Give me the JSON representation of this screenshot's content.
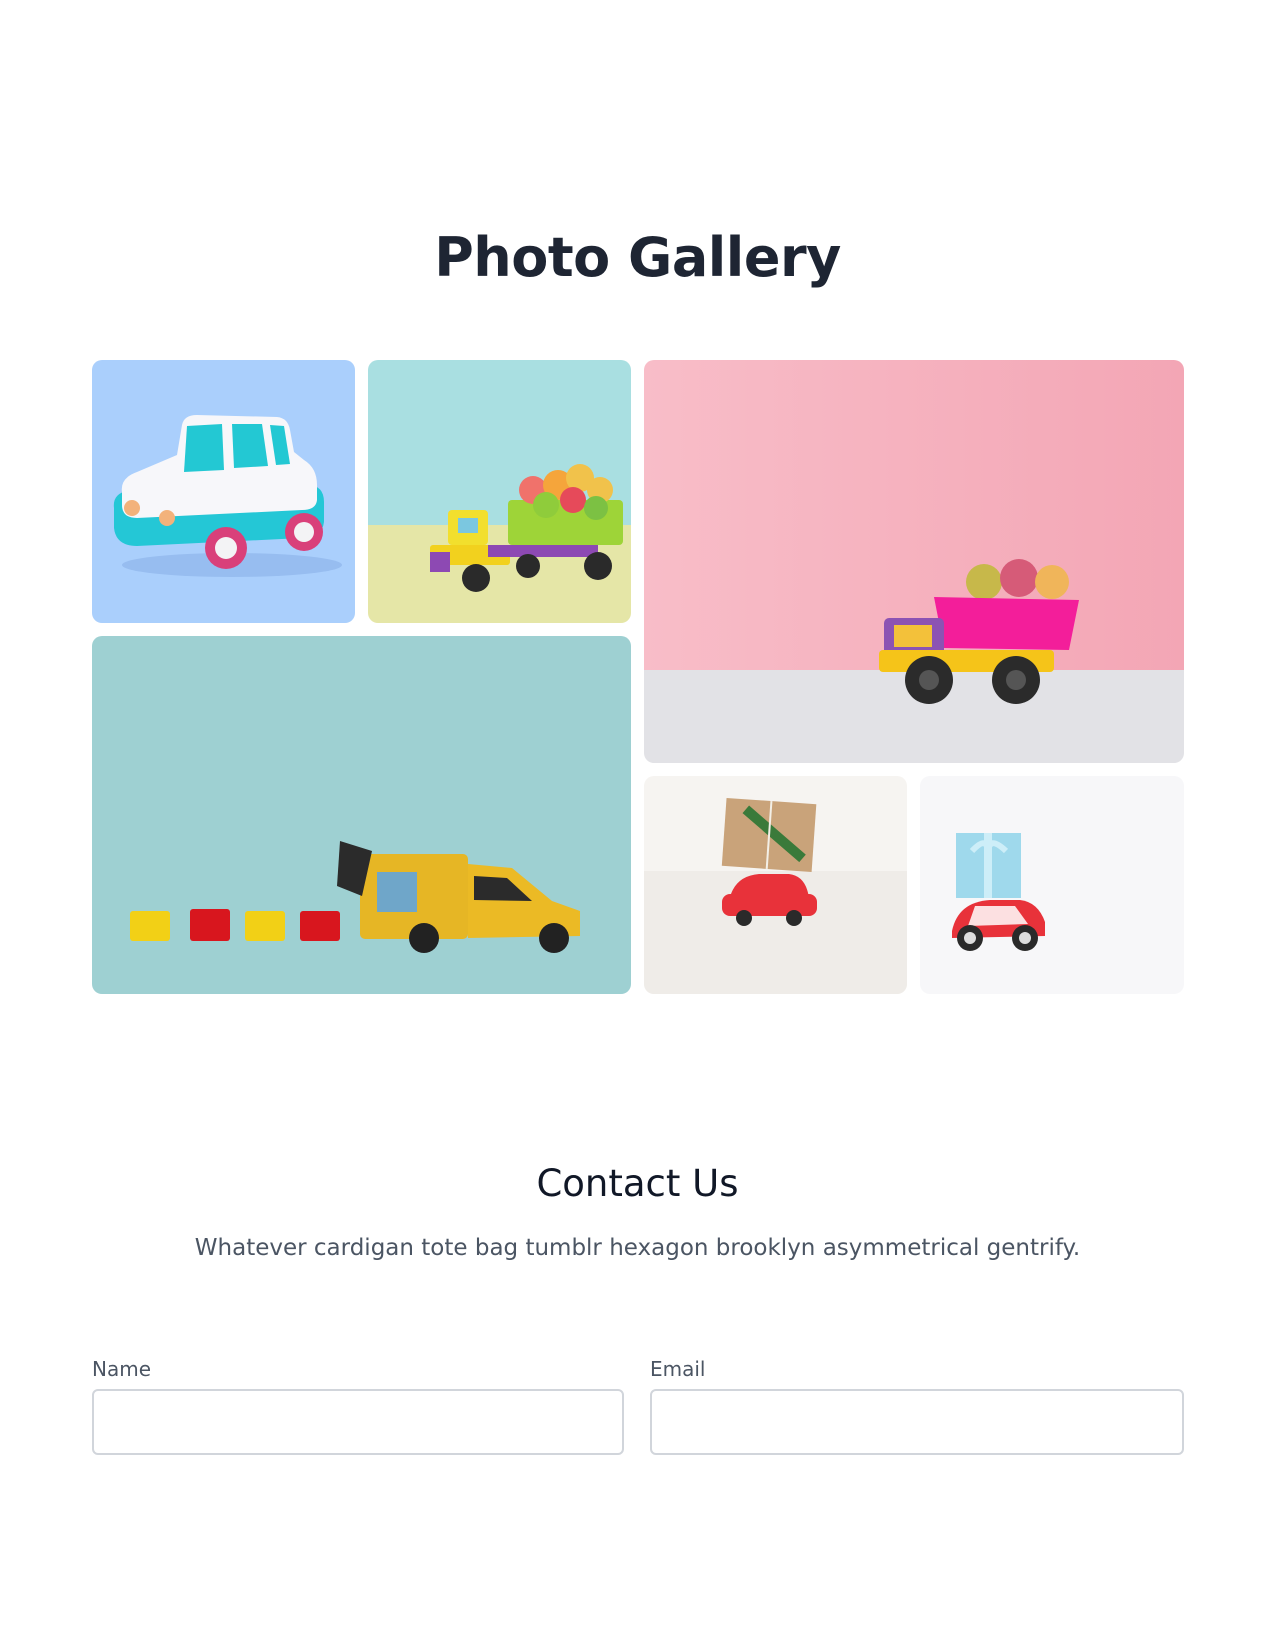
{
  "gallery": {
    "title": "Photo Gallery",
    "images": [
      {
        "name": "toy-car-white-teal",
        "background": "#aacffc"
      },
      {
        "name": "toy-truck-gummy-bears-teal",
        "background": "#a8dfe1"
      },
      {
        "name": "toy-dump-truck-pink",
        "background": "#f7b6c2"
      },
      {
        "name": "toy-yellow-van-blocks",
        "background": "#9ed0d2"
      },
      {
        "name": "red-car-kraft-gift",
        "background": "#f5f3f0"
      },
      {
        "name": "red-car-blue-gift",
        "background": "#f7f7f9"
      }
    ]
  },
  "contact": {
    "title": "Contact Us",
    "description": "Whatever cardigan tote bag tumblr hexagon brooklyn asymmetrical gentrify.",
    "fields": [
      {
        "label": "Name",
        "value": "",
        "placeholder": ""
      },
      {
        "label": "Email",
        "value": "",
        "placeholder": ""
      }
    ]
  }
}
